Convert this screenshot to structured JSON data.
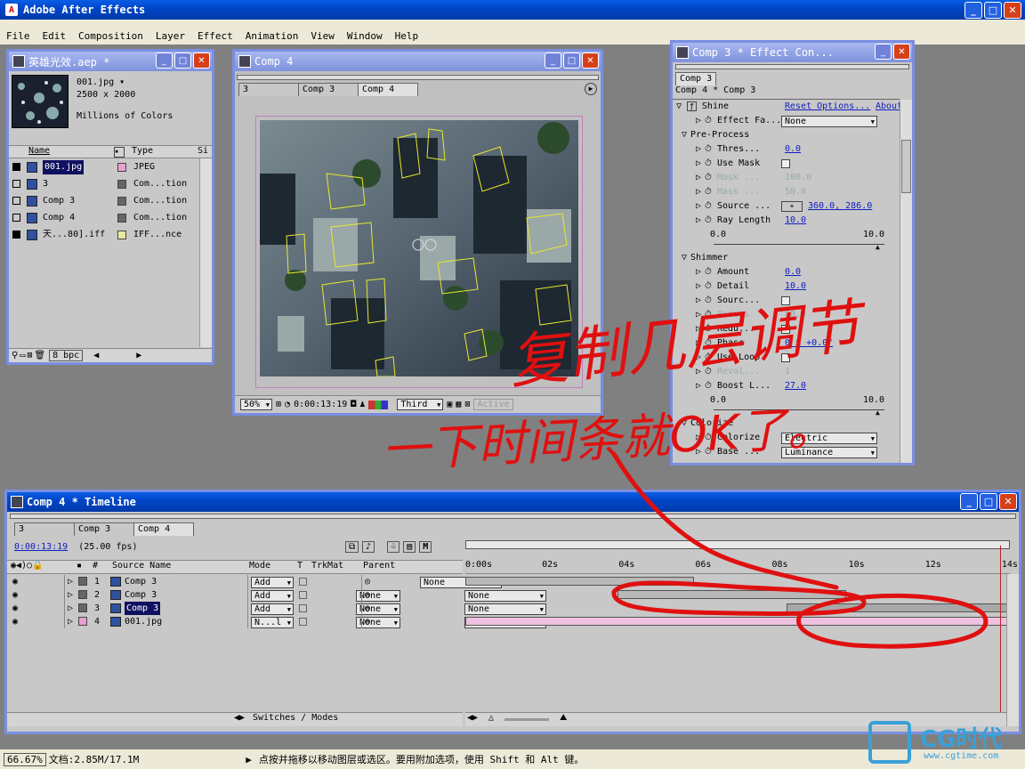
{
  "app": {
    "title": "Adobe After Effects"
  },
  "menu": [
    "File",
    "Edit",
    "Composition",
    "Layer",
    "Effect",
    "Animation",
    "View",
    "Window",
    "Help"
  ],
  "project": {
    "title": "英雄光效.aep *",
    "file_name": "001.jpg",
    "dimensions": "2500 x 2000",
    "colors": "Millions of Colors",
    "col_name": "Name",
    "col_type": "Type",
    "col_size": "Si",
    "items": [
      {
        "name": "001.jpg",
        "type": "JPEG",
        "color": "#e8a0d0"
      },
      {
        "name": "3",
        "type": "Com...tion",
        "color": "#666666"
      },
      {
        "name": "Comp 3",
        "type": "Com...tion",
        "color": "#666666"
      },
      {
        "name": "Comp 4",
        "type": "Com...tion",
        "color": "#666666"
      },
      {
        "name": "天...80].iff",
        "type": "IFF...nce",
        "color": "#e8e8a0"
      }
    ],
    "bpc": "8 bpc"
  },
  "comp": {
    "title": "Comp 4",
    "tabs": [
      "3",
      "Comp 3",
      "Comp 4"
    ],
    "zoom": "50%",
    "time": "0:00:13:19",
    "view": "Third",
    "active": "Active"
  },
  "effects": {
    "title": "Comp 3 * Effect Con...",
    "tab": "Comp 3",
    "subtitle": "Comp 4 * Comp 3",
    "effect_name": "Shine",
    "reset": "Reset Options...",
    "about": "About",
    "rows": [
      {
        "label": "Effect Fa...",
        "value": "None",
        "kind": "dropdown"
      },
      {
        "label": "Pre-Process",
        "value": "",
        "kind": "group"
      },
      {
        "label": "Thres...",
        "value": "0.0",
        "kind": "value"
      },
      {
        "label": "Use Mask",
        "value": "",
        "kind": "check"
      },
      {
        "label": "Mask ...",
        "value": "100.0",
        "kind": "disabled"
      },
      {
        "label": "Mask ...",
        "value": "50.0",
        "kind": "disabled"
      },
      {
        "label": "Source ...",
        "value": "360.0, 286.0",
        "kind": "point"
      },
      {
        "label": "Ray Length",
        "value": "10.0",
        "kind": "value"
      },
      {
        "label": "Shimmer",
        "value": "",
        "kind": "group"
      },
      {
        "label": "Amount",
        "value": "0.0",
        "kind": "value"
      },
      {
        "label": "Detail",
        "value": "10.0",
        "kind": "value"
      },
      {
        "label": "Sourc...",
        "value": "",
        "kind": "check"
      },
      {
        "label": "Radius",
        "value": "80.0",
        "kind": "disabled"
      },
      {
        "label": "Redu...",
        "value": "",
        "kind": "check"
      },
      {
        "label": "Phase",
        "value": "0 x +0.0°",
        "kind": "value"
      },
      {
        "label": "Use Loop",
        "value": "",
        "kind": "check"
      },
      {
        "label": "Revol...",
        "value": "1",
        "kind": "disabled"
      },
      {
        "label": "Boost L...",
        "value": "27.0",
        "kind": "value"
      },
      {
        "label": "Colorize",
        "value": "",
        "kind": "group"
      },
      {
        "label": "Colorize",
        "value": "Electric",
        "kind": "dropdown"
      },
      {
        "label": "Base ...",
        "value": "Luminance",
        "kind": "dropdown"
      }
    ],
    "slider_min": "0.0",
    "slider_max": "10.0"
  },
  "timeline": {
    "title": "Comp 4 * Timeline",
    "tabs": [
      "3",
      "Comp 3",
      "Comp 4"
    ],
    "time": "0:00:13:19",
    "fps": "(25.00 fps)",
    "headers": {
      "num": "#",
      "source": "Source Name",
      "mode": "Mode",
      "t": "T",
      "trkmat": "TrkMat",
      "parent": "Parent"
    },
    "ruler": [
      "0:00s",
      "02s",
      "04s",
      "06s",
      "08s",
      "10s",
      "12s",
      "14s"
    ],
    "current_time_fraction": 0.982,
    "layers": [
      {
        "num": "1",
        "name": "Comp 3",
        "mode": "Add",
        "trkmat": "",
        "parent": "None",
        "color": "#666666",
        "bar_start": 0.0,
        "bar_end": 0.42
      },
      {
        "num": "2",
        "name": "Comp 3",
        "mode": "Add",
        "trkmat": "None",
        "parent": "None",
        "color": "#666666",
        "bar_start": 0.28,
        "bar_end": 0.7
      },
      {
        "num": "3",
        "name": "Comp 3",
        "mode": "Add",
        "trkmat": "None",
        "parent": "None",
        "color": "#666666",
        "bar_start": 0.59,
        "bar_end": 1.0
      },
      {
        "num": "4",
        "name": "001.jpg",
        "mode": "N...l",
        "trkmat": "None",
        "parent": "None",
        "color": "#e8a0d0",
        "bar_start": 0.0,
        "bar_end": 1.0
      }
    ],
    "switches": "Switches / Modes"
  },
  "status": {
    "zoom": "66.67%",
    "doc": "文档:2.85M/17.1M",
    "hint": "点按并拖移以移动图层或选区。要用附加选项，使用 Shift 和 Alt 键。"
  },
  "annotation": {
    "line1": "复制几层调节",
    "line2": "一下时间条就OK了。"
  },
  "watermark": {
    "logo": "CG时代",
    "url": "www.cgtime.com"
  }
}
